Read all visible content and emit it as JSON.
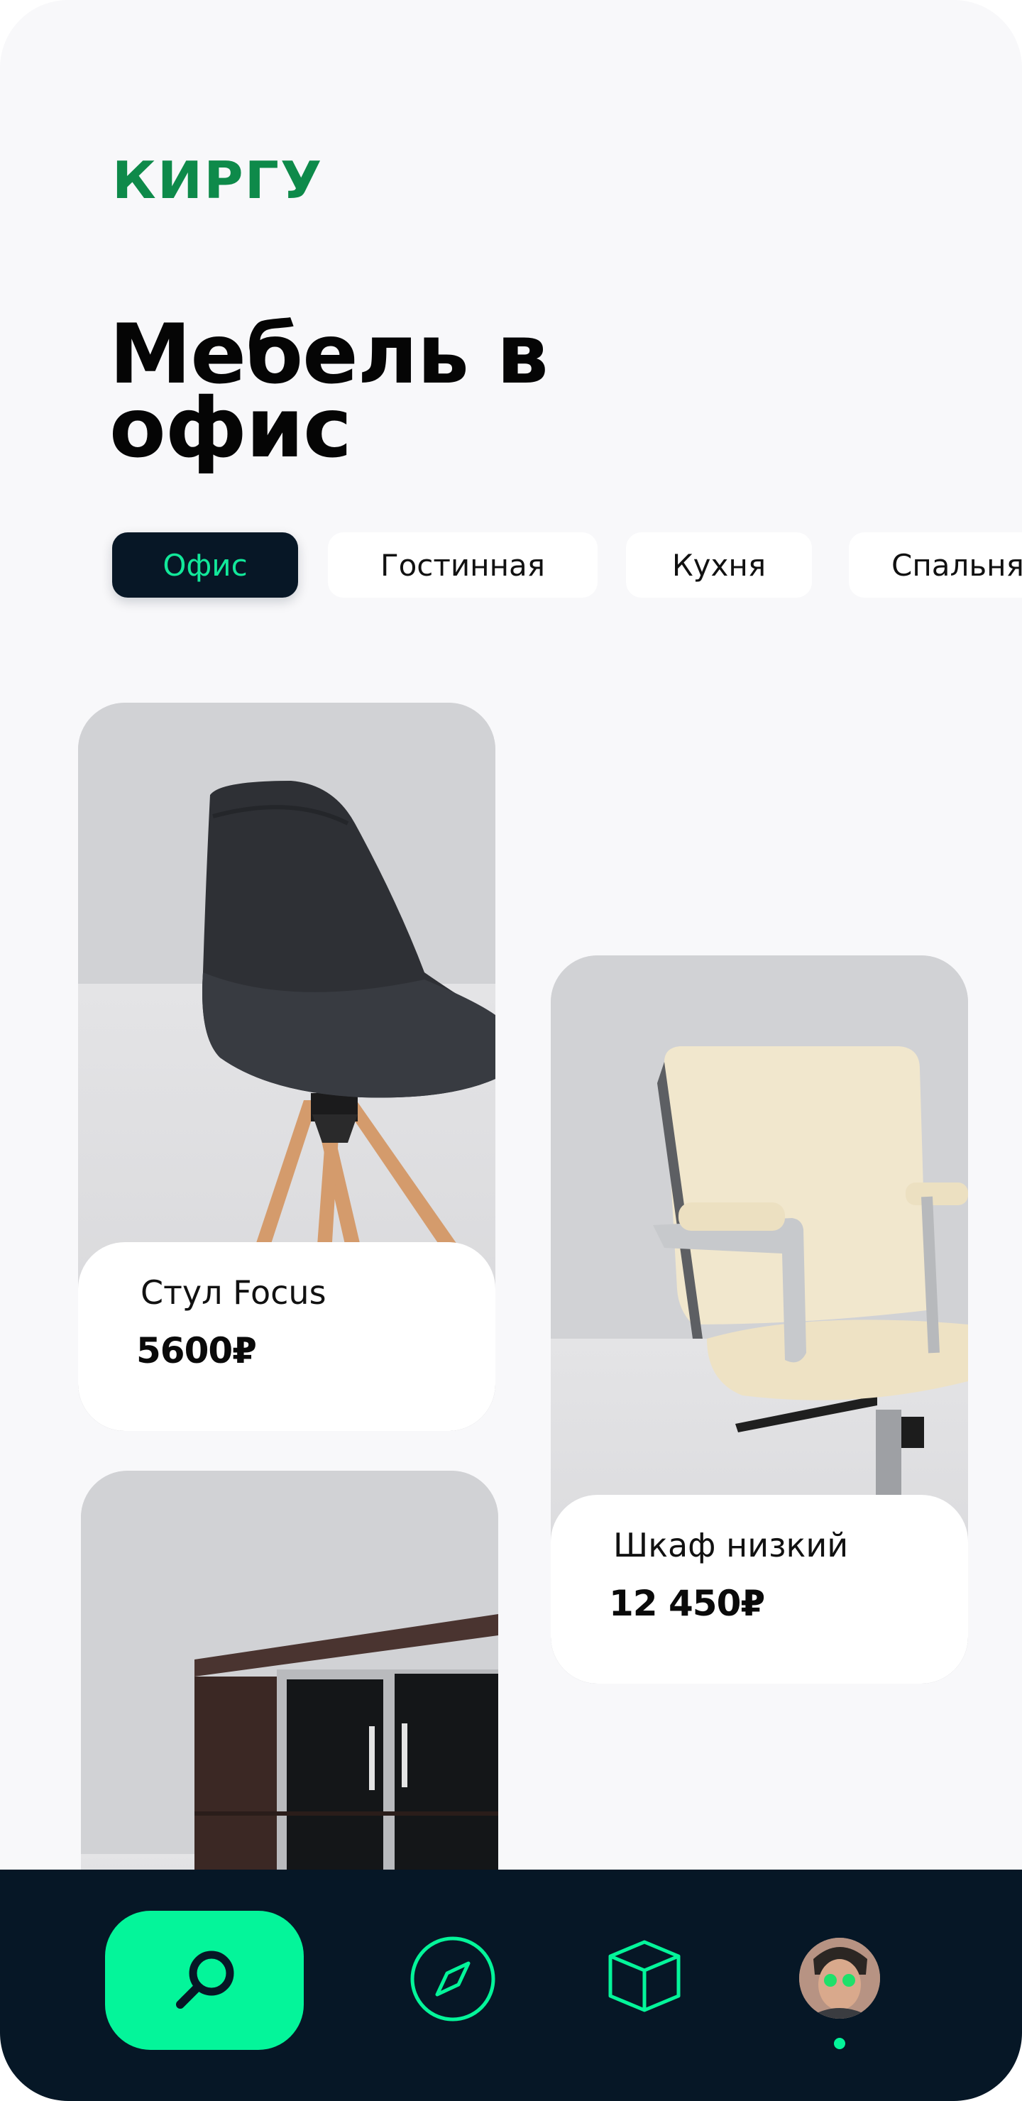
{
  "brand": {
    "logo_text": "КИРГУ",
    "color": "#0e8a4a"
  },
  "page_title": "Мебель в офис",
  "tabs": [
    {
      "label": "Офис",
      "active": true
    },
    {
      "label": "Гостинная",
      "active": false
    },
    {
      "label": "Кухня",
      "active": false
    },
    {
      "label": "Спальня",
      "active": false
    }
  ],
  "products": [
    {
      "name": "Стул Focus",
      "price": "5600₽",
      "image": "black-chair-wooden-legs"
    },
    {
      "name": "Шкаф низкий",
      "price": "12 450₽",
      "image": "cream-office-chair"
    },
    {
      "name": "",
      "price": "",
      "image": "dark-wood-cabinet-glass-doors"
    }
  ],
  "bottom_nav": {
    "items": [
      {
        "icon": "search-icon",
        "active": true
      },
      {
        "icon": "compass-icon",
        "active": false
      },
      {
        "icon": "box-icon",
        "active": false
      },
      {
        "icon": "avatar",
        "active": false
      }
    ]
  },
  "colors": {
    "accent": "#04f59a",
    "dark": "#061726",
    "background": "#f8f8fa"
  }
}
